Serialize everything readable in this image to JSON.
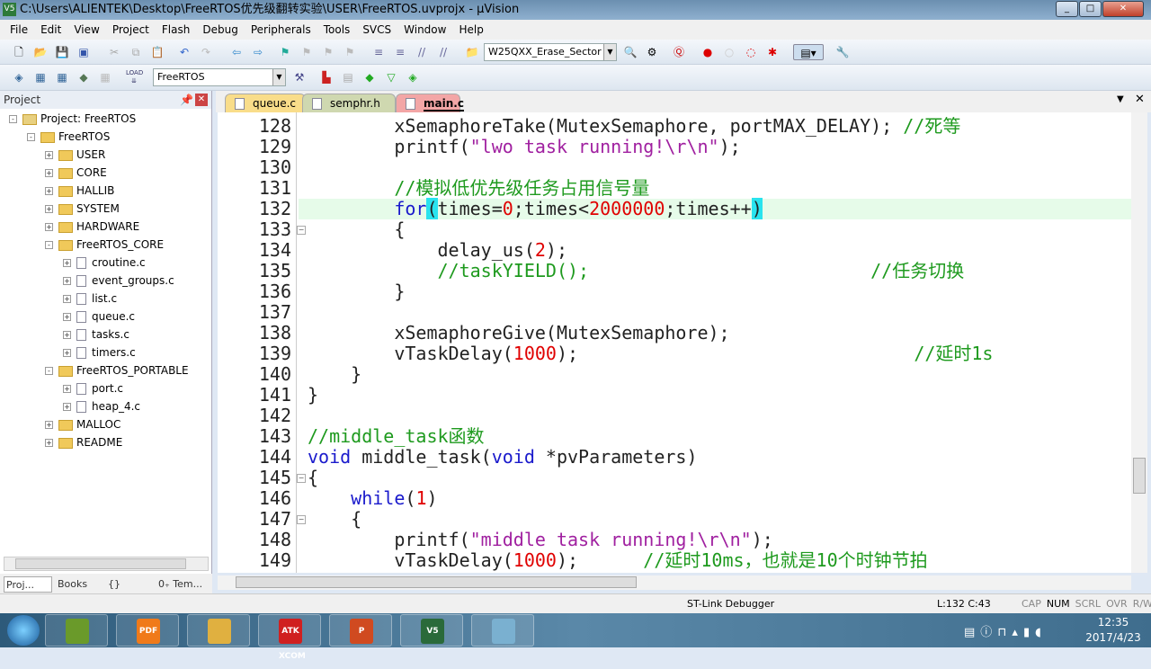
{
  "window": {
    "title": "C:\\Users\\ALIENTEK\\Desktop\\FreeRTOS优先级翻转实验\\USER\\FreeRTOS.uvprojx - µVision",
    "app_icon": "V5"
  },
  "menu": [
    "File",
    "Edit",
    "View",
    "Project",
    "Flash",
    "Debug",
    "Peripherals",
    "Tools",
    "SVCS",
    "Window",
    "Help"
  ],
  "toolbar": {
    "find_combo": "W25QXX_Erase_Sector",
    "target_combo": "FreeRTOS",
    "load_label": "LOAD"
  },
  "project": {
    "header": "Project",
    "tree": [
      {
        "label": "Project: FreeRTOS",
        "level": 0,
        "type": "root",
        "exp": "-"
      },
      {
        "label": "FreeRTOS",
        "level": 1,
        "type": "target",
        "exp": "-"
      },
      {
        "label": "USER",
        "level": 2,
        "type": "folder",
        "exp": "+"
      },
      {
        "label": "CORE",
        "level": 2,
        "type": "folder",
        "exp": "+"
      },
      {
        "label": "HALLIB",
        "level": 2,
        "type": "folder",
        "exp": "+"
      },
      {
        "label": "SYSTEM",
        "level": 2,
        "type": "folder",
        "exp": "+"
      },
      {
        "label": "HARDWARE",
        "level": 2,
        "type": "folder",
        "exp": "+"
      },
      {
        "label": "FreeRTOS_CORE",
        "level": 2,
        "type": "folder",
        "exp": "-"
      },
      {
        "label": "croutine.c",
        "level": 3,
        "type": "file",
        "exp": "+"
      },
      {
        "label": "event_groups.c",
        "level": 3,
        "type": "file",
        "exp": "+"
      },
      {
        "label": "list.c",
        "level": 3,
        "type": "file",
        "exp": "+"
      },
      {
        "label": "queue.c",
        "level": 3,
        "type": "file",
        "exp": "+"
      },
      {
        "label": "tasks.c",
        "level": 3,
        "type": "file",
        "exp": "+"
      },
      {
        "label": "timers.c",
        "level": 3,
        "type": "file",
        "exp": "+"
      },
      {
        "label": "FreeRTOS_PORTABLE",
        "level": 2,
        "type": "folder",
        "exp": "-"
      },
      {
        "label": "port.c",
        "level": 3,
        "type": "file",
        "exp": "+"
      },
      {
        "label": "heap_4.c",
        "level": 3,
        "type": "file",
        "exp": "+"
      },
      {
        "label": "MALLOC",
        "level": 2,
        "type": "folder",
        "exp": "+"
      },
      {
        "label": "README",
        "level": 2,
        "type": "folder",
        "exp": "+"
      }
    ],
    "bottom_tabs": [
      "Proj...",
      "Books",
      "{} Func...",
      "0₊ Tem..."
    ]
  },
  "file_tabs": [
    {
      "label": "queue.c",
      "color": "#f9dd8a",
      "active": false
    },
    {
      "label": "semphr.h",
      "color": "#cfd8b0",
      "active": false
    },
    {
      "label": "main.c",
      "color": "#f3a6a6",
      "active": true
    }
  ],
  "editor": {
    "highlight_line": 132,
    "lines": [
      {
        "n": "128",
        "fold": "",
        "tokens": [
          {
            "t": "        xSemaphoreTake(MutexSemaphore, portMAX_DELAY); "
          },
          {
            "t": "//死等",
            "c": "cmt"
          }
        ]
      },
      {
        "n": "129",
        "fold": "",
        "tokens": [
          {
            "t": "        printf("
          },
          {
            "t": "\"lwo task running!\\r\\n\"",
            "c": "str"
          },
          {
            "t": ");"
          }
        ]
      },
      {
        "n": "130",
        "fold": "",
        "tokens": []
      },
      {
        "n": "131",
        "fold": "",
        "tokens": [
          {
            "t": "        "
          },
          {
            "t": "//模拟低优先级任务占用信号量",
            "c": "cmt"
          }
        ]
      },
      {
        "n": "132",
        "fold": "",
        "tokens": [
          {
            "t": "        "
          },
          {
            "t": "for",
            "c": "kw"
          },
          {
            "t": "(",
            "c": "br"
          },
          {
            "t": "times="
          },
          {
            "t": "0",
            "c": "num"
          },
          {
            "t": ";times<"
          },
          {
            "t": "2000000",
            "c": "num"
          },
          {
            "t": ";times++"
          },
          {
            "t": ")",
            "c": "br"
          }
        ]
      },
      {
        "n": "133",
        "fold": "-",
        "tokens": [
          {
            "t": "        {"
          }
        ]
      },
      {
        "n": "134",
        "fold": "",
        "tokens": [
          {
            "t": "            delay_us("
          },
          {
            "t": "2",
            "c": "num"
          },
          {
            "t": ");"
          }
        ]
      },
      {
        "n": "135",
        "fold": "",
        "tokens": [
          {
            "t": "            "
          },
          {
            "t": "//taskYIELD();                          //任务切换",
            "c": "cmt"
          }
        ]
      },
      {
        "n": "136",
        "fold": "",
        "tokens": [
          {
            "t": "        }"
          }
        ]
      },
      {
        "n": "137",
        "fold": "",
        "tokens": []
      },
      {
        "n": "138",
        "fold": "",
        "tokens": [
          {
            "t": "        xSemaphoreGive(MutexSemaphore);"
          }
        ]
      },
      {
        "n": "139",
        "fold": "",
        "tokens": [
          {
            "t": "        vTaskDelay("
          },
          {
            "t": "1000",
            "c": "num"
          },
          {
            "t": ");                               "
          },
          {
            "t": "//延时1s",
            "c": "cmt"
          }
        ]
      },
      {
        "n": "140",
        "fold": "",
        "tokens": [
          {
            "t": "    }"
          }
        ]
      },
      {
        "n": "141",
        "fold": "",
        "tokens": [
          {
            "t": "}"
          }
        ]
      },
      {
        "n": "142",
        "fold": "",
        "tokens": []
      },
      {
        "n": "143",
        "fold": "",
        "tokens": [
          {
            "t": "//middle_task函数",
            "c": "cmt"
          }
        ]
      },
      {
        "n": "144",
        "fold": "",
        "tokens": [
          {
            "t": "void",
            "c": "kw"
          },
          {
            "t": " middle_task("
          },
          {
            "t": "void",
            "c": "kw"
          },
          {
            "t": " *pvParameters)"
          }
        ]
      },
      {
        "n": "145",
        "fold": "-",
        "tokens": [
          {
            "t": "{"
          }
        ]
      },
      {
        "n": "146",
        "fold": "",
        "tokens": [
          {
            "t": "    "
          },
          {
            "t": "while",
            "c": "kw"
          },
          {
            "t": "("
          },
          {
            "t": "1",
            "c": "num"
          },
          {
            "t": ")"
          }
        ]
      },
      {
        "n": "147",
        "fold": "-",
        "tokens": [
          {
            "t": "    {"
          }
        ]
      },
      {
        "n": "148",
        "fold": "",
        "tokens": [
          {
            "t": "        printf("
          },
          {
            "t": "\"middle task running!\\r\\n\"",
            "c": "str"
          },
          {
            "t": ");"
          }
        ]
      },
      {
        "n": "149",
        "fold": "",
        "tokens": [
          {
            "t": "        vTaskDelay("
          },
          {
            "t": "1000",
            "c": "num"
          },
          {
            "t": ");      "
          },
          {
            "t": "//延时10ms，也就是10个时钟节拍",
            "c": "cmt"
          }
        ]
      }
    ]
  },
  "status": {
    "debugger": "ST-Link Debugger",
    "position": "L:132 C:43",
    "indicators": [
      "CAP",
      "NUM",
      "SCRL",
      "OVR",
      "R/W"
    ]
  },
  "taskbar": {
    "apps": [
      {
        "name": "notepad++",
        "label": "",
        "color": "#6a9a2a"
      },
      {
        "name": "foxit-pdf",
        "label": "PDF",
        "color": "#f07a1a"
      },
      {
        "name": "explorer",
        "label": "",
        "color": "#e0b040"
      },
      {
        "name": "atk-xcom",
        "label": "ATK XCOM",
        "color": "#d02020"
      },
      {
        "name": "powerpoint",
        "label": "P",
        "color": "#d04a20"
      },
      {
        "name": "keil-uvision",
        "label": "V5",
        "color": "#2a6a3a"
      },
      {
        "name": "notepad",
        "label": "",
        "color": "#7ab0d0"
      }
    ],
    "time": "12:35",
    "date": "2017/4/23"
  }
}
